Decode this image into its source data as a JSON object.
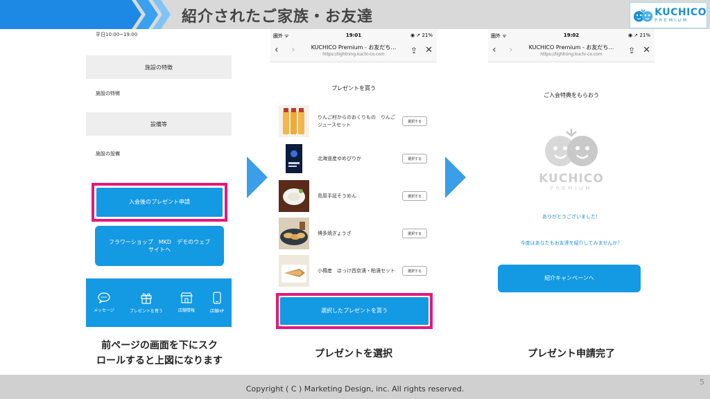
{
  "header": {
    "title": "紹介されたご家族・お友達",
    "logo_main": "KUCHICO",
    "logo_sub": "PREMIUM",
    "chevron_colors": [
      "#1e88e5",
      "#3aa0f0",
      "#7fc3f7"
    ]
  },
  "panel1": {
    "hours": "平日10:00~19:00",
    "section1_title": "施設の特徴",
    "section1_body": "施設の特徴",
    "section2_title": "設備等",
    "section2_body": "施設の設備",
    "present_button": "入会後のプレゼント申請",
    "shop_button": "フラワーショップ　MKD　デモのウェブサイトへ",
    "nav": [
      {
        "label": "メッセージ",
        "icon": "message-icon"
      },
      {
        "label": "プレゼントを貰う",
        "icon": "gift-icon"
      },
      {
        "label": "店舗情報",
        "icon": "store-icon"
      },
      {
        "label": "店舗HP",
        "icon": "phone-icon"
      }
    ]
  },
  "panel2": {
    "status_left": "圏外 ᯤ",
    "time": "19:01",
    "status_right": "◉ ➚ 21%",
    "nav_title": "KUCHICO Premium - お友だち…",
    "nav_url": "https://lightning.kuchi-co.com",
    "heading": "プレゼントを貰う",
    "select_label": "選択する",
    "items": [
      {
        "name": "りんご村からのおくりもの　りんごジュースセット"
      },
      {
        "name": "北海道産ゆめぴりか"
      },
      {
        "name": "島原手延そうめん"
      },
      {
        "name": "博多焼ぎょうざ"
      },
      {
        "name": "小樽産　ほっけ西京漬・粕漬セット"
      }
    ],
    "buy_button": "選択したプレゼントを貰う"
  },
  "panel3": {
    "status_left": "圏外 ᯤ",
    "time": "19:02",
    "status_right": "◉ ➚ 21%",
    "nav_title": "KUCHICO Premium - お友だち…",
    "nav_url": "https://lightning.kuchi-co.com",
    "heading": "ご入会特典をもらおう",
    "logo_main": "KUCHICO",
    "logo_sub": "PREMIUM",
    "thanks": "ありがとうございました！",
    "invite_prompt": "今度はあなたもお友達を紹介してみませんか？",
    "campaign_button": "紹介キャンペーンへ"
  },
  "captions": {
    "c1_line1": "前ページの画面を下にスク",
    "c1_line2": "ロールすると上図になります",
    "c2": "プレゼントを選択",
    "c3": "プレゼント申請完了"
  },
  "footer": {
    "copyright": "Copyright ( C ) Marketing Design, inc. All rights reserved.",
    "page_number": "5"
  },
  "colors": {
    "accent_blue": "#1499e3",
    "highlight_pink": "#e5177c",
    "arrow_blue": "#3a9ee8"
  }
}
